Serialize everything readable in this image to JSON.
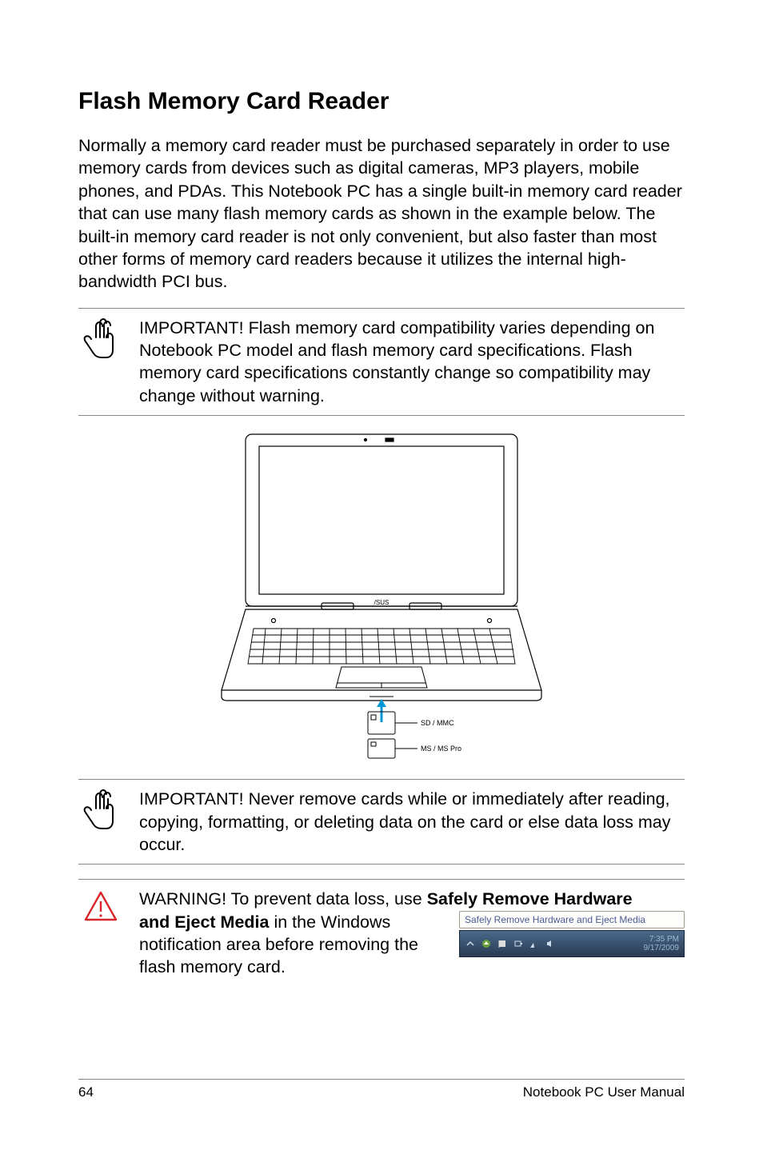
{
  "heading": "Flash Memory Card Reader",
  "intro": "Normally a memory card reader must be purchased separately in order to use memory cards from devices such as digital cameras, MP3 players, mobile phones, and PDAs. This Notebook PC has a single built-in memory card reader that can use many flash memory cards as shown in the example below. The built-in memory card reader is not only convenient, but also faster than most other forms of memory card readers because it utilizes the internal high-bandwidth PCI bus.",
  "note1": "IMPORTANT! Flash memory card compatibility varies depending on Notebook PC model and flash memory card specifications. Flash memory card specifications constantly change so compatibility may change without warning.",
  "card_labels": {
    "sd": "SD / MMC",
    "ms": "MS / MS Pro"
  },
  "note2": "IMPORTANT!  Never remove cards while or immediately after reading, copying, formatting, or deleting data on the card or else data loss may occur.",
  "warning": {
    "prefix": "WARNING! To prevent data loss, use ",
    "bold": "Safely Remove Hardware and Eject Media",
    "suffix": " in the Windows notification area before removing the flash memory card."
  },
  "tooltip": "Safely Remove Hardware and Eject Media",
  "taskbar": {
    "time": "7:35 PM",
    "date": "9/17/2009"
  },
  "footer": {
    "page": "64",
    "title": "Notebook PC User Manual"
  }
}
